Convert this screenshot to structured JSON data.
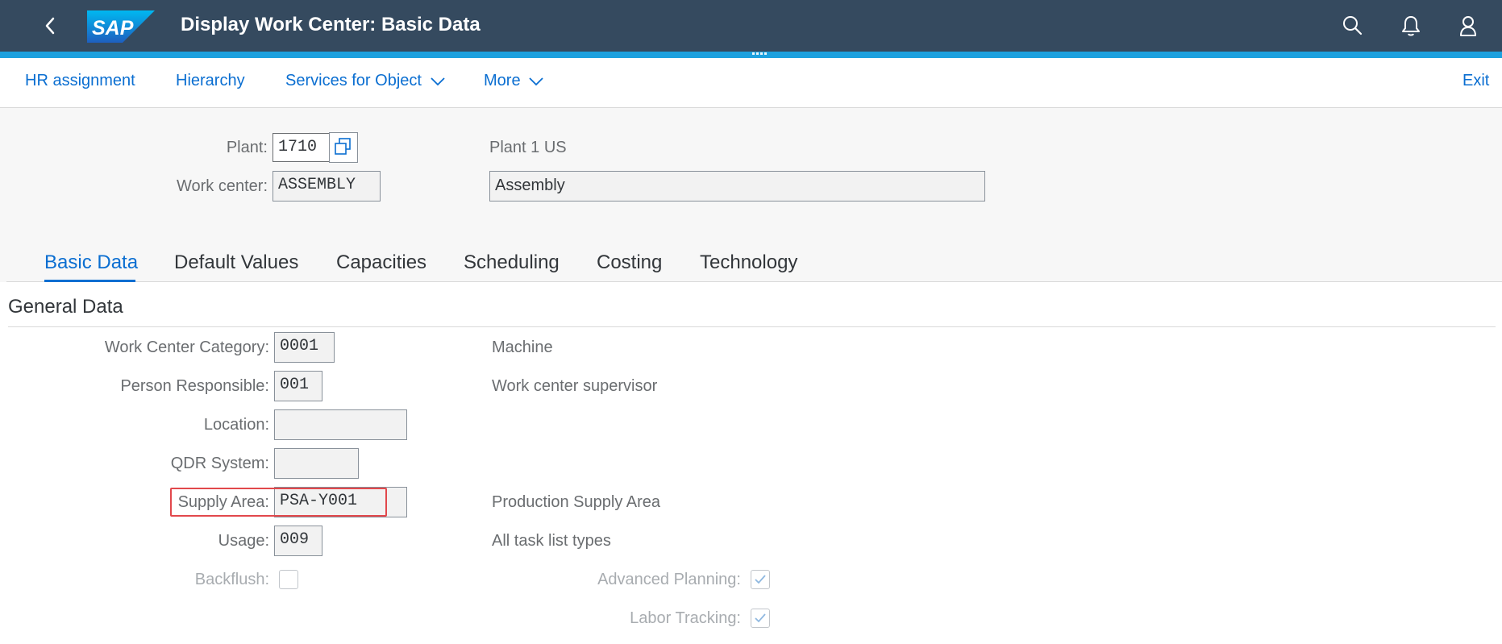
{
  "shell": {
    "title": "Display Work Center: Basic Data",
    "logo_text": "SAP",
    "icons": [
      "back-icon",
      "search-icon",
      "notifications-icon",
      "user-icon"
    ],
    "bg_color": "#354a5f",
    "accent_color": "#1da1df"
  },
  "toolbar": {
    "hr_assignment": "HR assignment",
    "hierarchy": "Hierarchy",
    "services_for_object": "Services for Object",
    "more": "More",
    "exit": "Exit"
  },
  "header": {
    "plant_label": "Plant:",
    "plant_value": "1710",
    "plant_text": "Plant 1 US",
    "work_center_label": "Work center:",
    "work_center_value": "ASSEMBLY",
    "work_center_desc": "Assembly"
  },
  "tabs": [
    {
      "label": "Basic Data",
      "selected": true
    },
    {
      "label": "Default Values",
      "selected": false
    },
    {
      "label": "Capacities",
      "selected": false
    },
    {
      "label": "Scheduling",
      "selected": false
    },
    {
      "label": "Costing",
      "selected": false
    },
    {
      "label": "Technology",
      "selected": false
    }
  ],
  "general_data": {
    "title": "General Data",
    "work_center_category": {
      "label": "Work Center Category:",
      "value": "0001",
      "text": "Machine"
    },
    "person_responsible": {
      "label": "Person Responsible:",
      "value": "001",
      "text": "Work center supervisor"
    },
    "location": {
      "label": "Location:",
      "value": ""
    },
    "qdr_system": {
      "label": "QDR System:",
      "value": ""
    },
    "supply_area": {
      "label": "Supply Area:",
      "value": "PSA-Y001",
      "text": "Production Supply Area"
    },
    "usage": {
      "label": "Usage:",
      "value": "009",
      "text": "All task list types"
    },
    "backflush": {
      "label": "Backflush:",
      "checked": false
    },
    "advanced_planning": {
      "label": "Advanced Planning:",
      "checked": true
    },
    "labor_tracking": {
      "label": "Labor Tracking:",
      "checked": true
    }
  },
  "highlight_color": "#e2484c"
}
